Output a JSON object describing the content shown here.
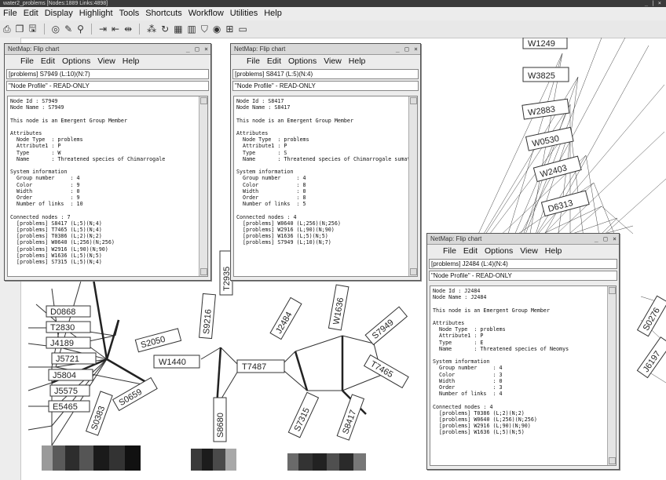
{
  "app": {
    "title": "water2_problems [Nodes:1889 Links:4898]",
    "window_buttons": "_ | ×",
    "menu": [
      "File",
      "Edit",
      "Display",
      "Highlight",
      "Tools",
      "Shortcuts",
      "Workflow",
      "Utilities",
      "Help"
    ]
  },
  "toolbar_icons": [
    "print-icon",
    "copy-icon",
    "save-icon",
    "circle-icon",
    "pencil-icon",
    "binoculars-icon",
    "arrows-in-icon",
    "arrows-out-icon",
    "arrows-lr-icon",
    "nodes-icon",
    "refresh-icon",
    "grid-icon",
    "grid2-icon",
    "filter-icon",
    "target-icon",
    "layout-icon",
    "window-icon"
  ],
  "left_tools": [
    "move-icon",
    "pointer-icon",
    "select-icon",
    "link-icon",
    "node-icon",
    "expand-icon",
    "pan-icon",
    "zoom-icon",
    "layer-icon",
    "search-icon"
  ],
  "flip_windows": [
    {
      "title": "NetMap: Flip chart",
      "menu": [
        "File",
        "Edit",
        "Options",
        "View",
        "Help"
      ],
      "header_field": "[problems] S7949 (L:10)(N:7)",
      "profile_field": "\"Node Profile\" - READ-ONLY",
      "content": "Node Id : S7949\nNode Name : S7949\n\nThis node is an Emergent Group Member\n\nAttributes\n  Node Type  : problems\n  Attribute1 : P\n  Type       : W\n  Name       : Threatened species of Chimarrogale\n\nSystem information\n  Group number     : 4\n  Color            : 9\n  Width            : 0\n  Order            : 9\n  Number of links  : 10\n\nConnected nodes : 7\n  [problems] S8417 (L;5)(N;4)\n  [problems] T7465 (L;5)(N;4)\n  [problems] T0386 (L;2)(N;2)\n  [problems] W0640 (L;256)(N;256)\n  [problems] W2916 (L;90)(N;90)\n  [problems] W1636 (L;5)(N;5)\n  [problems] S7315 (L;5)(N;4)"
    },
    {
      "title": "NetMap: Flip chart",
      "menu": [
        "File",
        "Edit",
        "Options",
        "View",
        "Help"
      ],
      "header_field": "[problems] S8417 (L:5)(N:4)",
      "profile_field": "\"Node Profile\" - READ-ONLY",
      "content": "Node Id : S8417\nNode Name : S8417\n\nThis node is an Emergent Group Member\n\nAttributes\n  Node Type  : problems\n  Attribute1 : P\n  Type       : S\n  Name       : Threatened species of Chimarrogale sumatrana\n\nSystem information\n  Group number     : 4\n  Color            : 8\n  Width            : 0\n  Order            : 8\n  Number of links  : 5\n\nConnected nodes : 4\n  [problems] W0640 (L;256)(N;256)\n  [problems] W2916 (L;90)(N;90)\n  [problems] W1636 (L;5)(N;5)\n  [problems] S7949 (L;10)(N;7)"
    },
    {
      "title": "NetMap: Flip chart",
      "menu": [
        "File",
        "Edit",
        "Options",
        "View",
        "Help"
      ],
      "header_field": "[problems] J2484 (L:4)(N:4)",
      "profile_field": "\"Node Profile\" - READ-ONLY",
      "content": "Node Id : J2484\nNode Name : J2484\n\nThis node is an Emergent Group Member\n\nAttributes\n  Node Type  : problems\n  Attribute1 : P\n  Type       : E\n  Name       : Threatened species of Neomys\n\nSystem information\n  Group number     : 4\n  Color            : 3\n  Width            : 0\n  Order            : 3\n  Number of links  : 4\n\nConnected nodes : 4\n  [problems] T0386 (L;2)(N;2)\n  [problems] W0640 (L;256)(N;256)\n  [problems] W2916 (L;90)(N;90)\n  [problems] W1636 (L;5)(N;5)"
    }
  ],
  "graph_labels": {
    "right": [
      "W1249",
      "W3825",
      "W2883",
      "W0530",
      "W2403",
      "D6313",
      "J6197",
      "S0276"
    ],
    "left": [
      "D0868",
      "T2830",
      "J4189",
      "J5721",
      "J5804",
      "J5575",
      "E5465",
      "S2050",
      "S0659",
      "S0383",
      "T2935"
    ],
    "middle": [
      "W1440",
      "S9216",
      "T7487",
      "S8680",
      "J2484",
      "W1636",
      "S7949",
      "T7465",
      "S7315",
      "S8417"
    ]
  },
  "colors": {
    "background": "#ffffff",
    "window_bg": "#ececec",
    "titlebar": "#3a3a3a",
    "link": "#333333"
  }
}
